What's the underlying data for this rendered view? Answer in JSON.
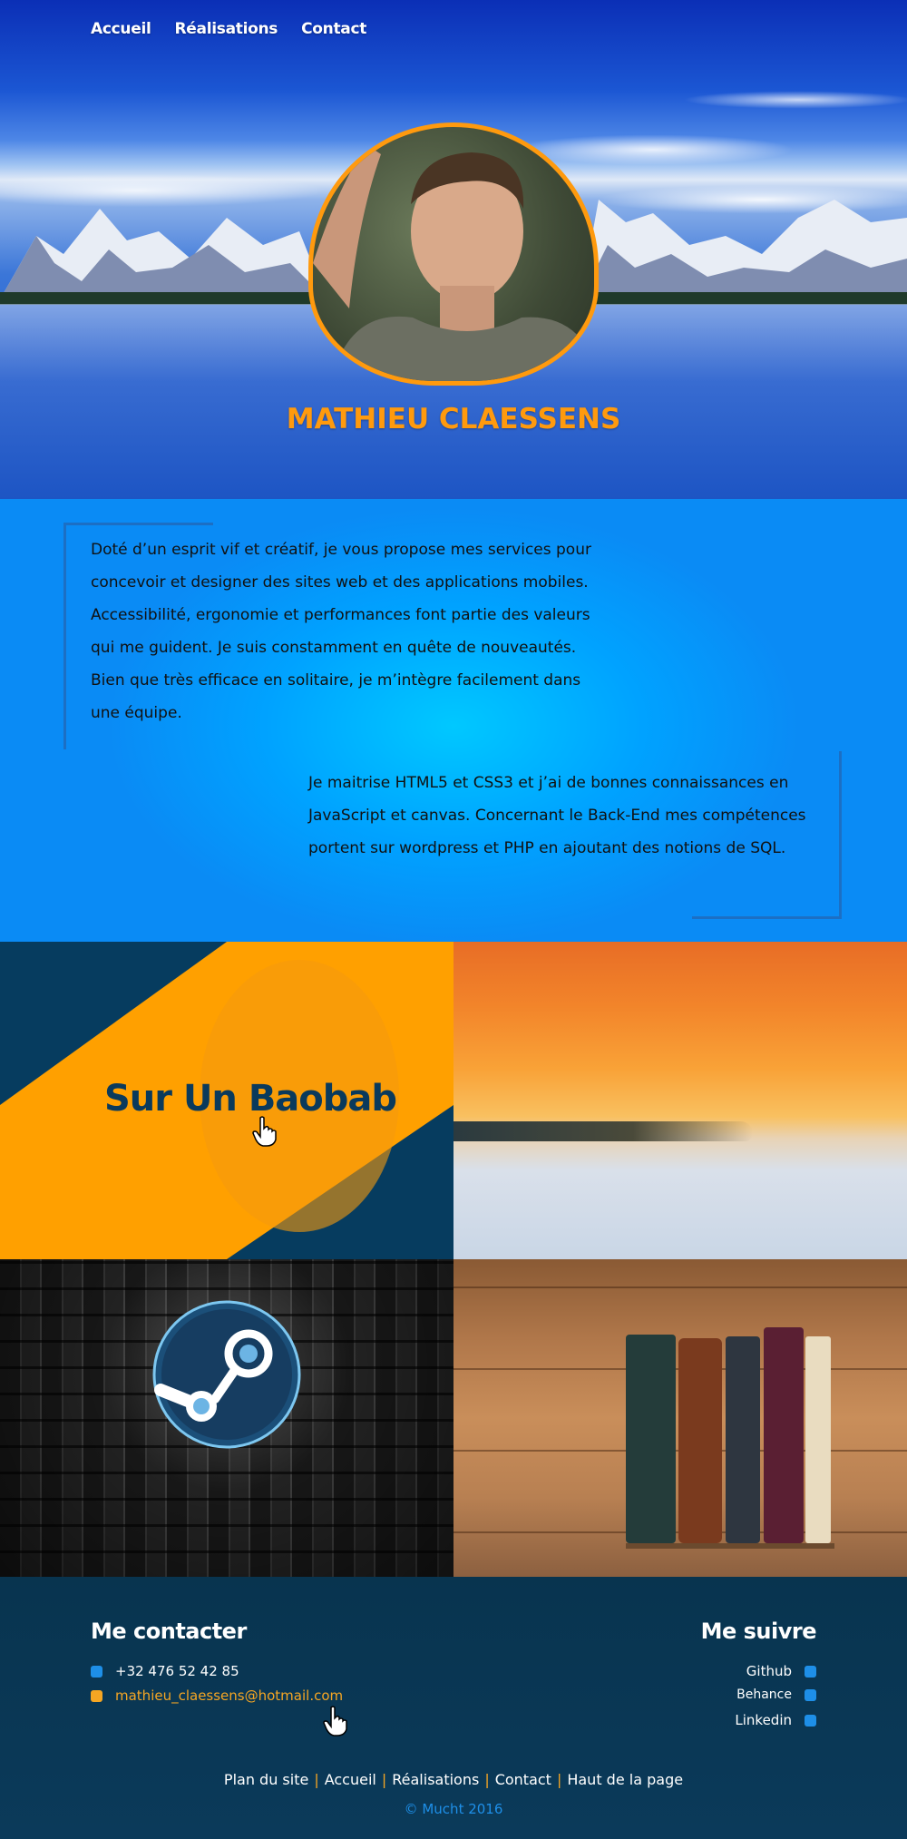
{
  "nav": {
    "items": [
      "Accueil",
      "Réalisations",
      "Contact"
    ]
  },
  "hero": {
    "name": "MATHIEU CLAESSENS"
  },
  "about": {
    "paragraph1": "Doté d’un esprit vif et créatif, je vous propose mes services pour concevoir et designer des sites web et des applications mobiles. Accessibilité, ergonomie et performances font partie des valeurs qui me guident. Je suis constamment en quête de nouveautés. Bien que très efficace en solitaire, je m’intègre facilement dans une équipe.",
    "paragraph2": "Je maitrise HTML5 et CSS3 et j’ai de bonnes connaissances en JavaScript et canvas. Concernant le Back-End mes compétences portent sur wordpress et PHP en ajoutant des notions de SQL."
  },
  "projects": {
    "baobab_title": "Sur Un Baobab"
  },
  "footer": {
    "contact_title": "Me contacter",
    "phone": "+32 476 52 42 85",
    "email": "mathieu_claessens@hotmail.com",
    "follow_title": "Me suivre",
    "follow": [
      "Github",
      "Behance",
      "Linkedin"
    ],
    "links": [
      "Plan du site",
      "Accueil",
      "Réalisations",
      "Contact",
      "Haut de la page"
    ],
    "copyright": "© Mucht 2016"
  },
  "colors": {
    "accent": "#ff9a0e",
    "blue": "#00a2ff",
    "dark": "#0a3a5c",
    "link_blue": "#1e8fe8"
  }
}
